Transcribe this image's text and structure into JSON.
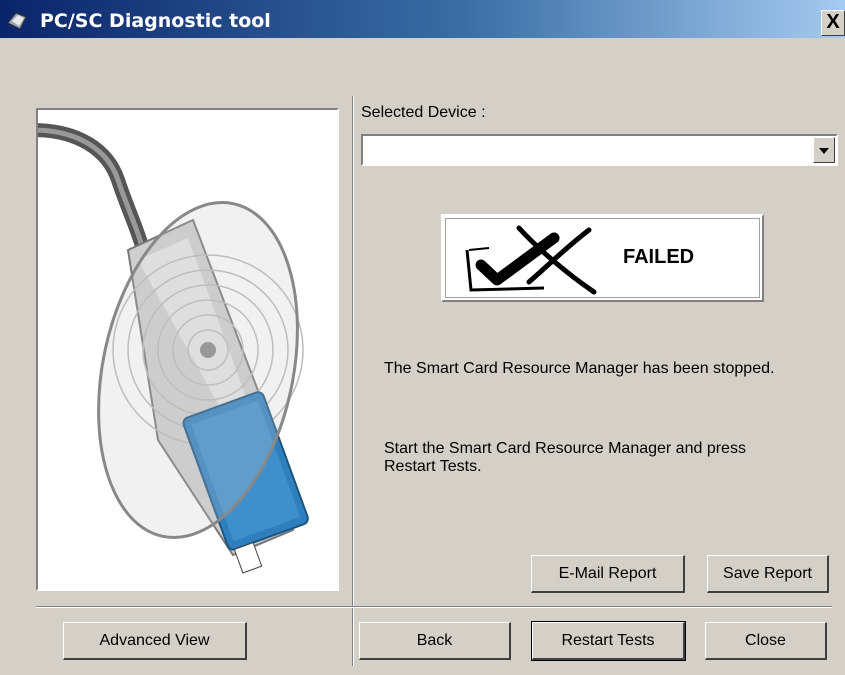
{
  "window": {
    "title": "PC/SC Diagnostic tool",
    "close_label": "X"
  },
  "device": {
    "label": "Selected Device :",
    "selected": ""
  },
  "status": {
    "result": "FAILED",
    "icon": "failed-check-icon"
  },
  "messages": {
    "line1": "The Smart Card Resource Manager has been stopped.",
    "line2a": "Start the Smart Card Resource Manager and press",
    "line2b": "Restart Tests."
  },
  "buttons": {
    "email": "E-Mail Report",
    "save": "Save Report",
    "advanced": "Advanced View",
    "back": "Back",
    "restart": "Restart Tests",
    "close": "Close"
  }
}
